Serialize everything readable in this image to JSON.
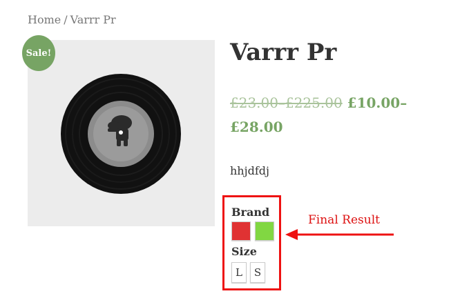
{
  "breadcrumb": {
    "home": "Home",
    "separator": "/",
    "current": "Varrr Pr"
  },
  "badge": {
    "label": "Sale!"
  },
  "product": {
    "title": "Varrr Pr",
    "price": {
      "old_range": "£23.00–£225.00",
      "new_range": "£10.00–£28.00"
    },
    "description": "hhjdfdj",
    "image_icon": "vinyl-record-image"
  },
  "variations": {
    "brand_label": "Brand",
    "brand_swatches": [
      {
        "color": "#e03233"
      },
      {
        "color": "#81d742"
      }
    ],
    "size_label": "Size",
    "sizes": [
      "L",
      "S"
    ]
  },
  "annotation": {
    "label": "Final Result",
    "color": "#ee1111"
  },
  "colors": {
    "accent": "#77a464",
    "highlight_border": "#ee1111"
  }
}
